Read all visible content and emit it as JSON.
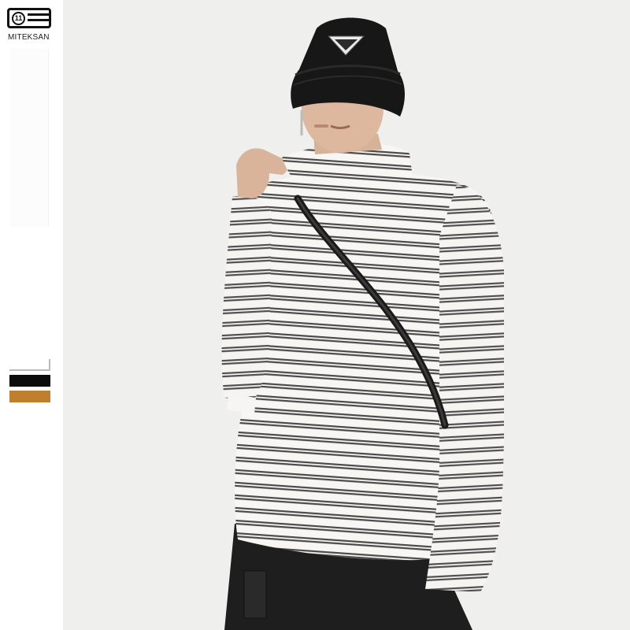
{
  "brand": {
    "badge_number": "11",
    "name": "MITEKSAN"
  },
  "color_options": [
    {
      "name": "white",
      "color": "#ffffff"
    },
    {
      "name": "black",
      "color": "#0c0c0c"
    },
    {
      "name": "brown",
      "color": "#c17f2e"
    }
  ],
  "photo": {
    "background_color": "#efefed",
    "shirt_stripe_color": "#4a4a4a",
    "hat_color": "#171717",
    "pants_color": "#1e1e1e"
  }
}
